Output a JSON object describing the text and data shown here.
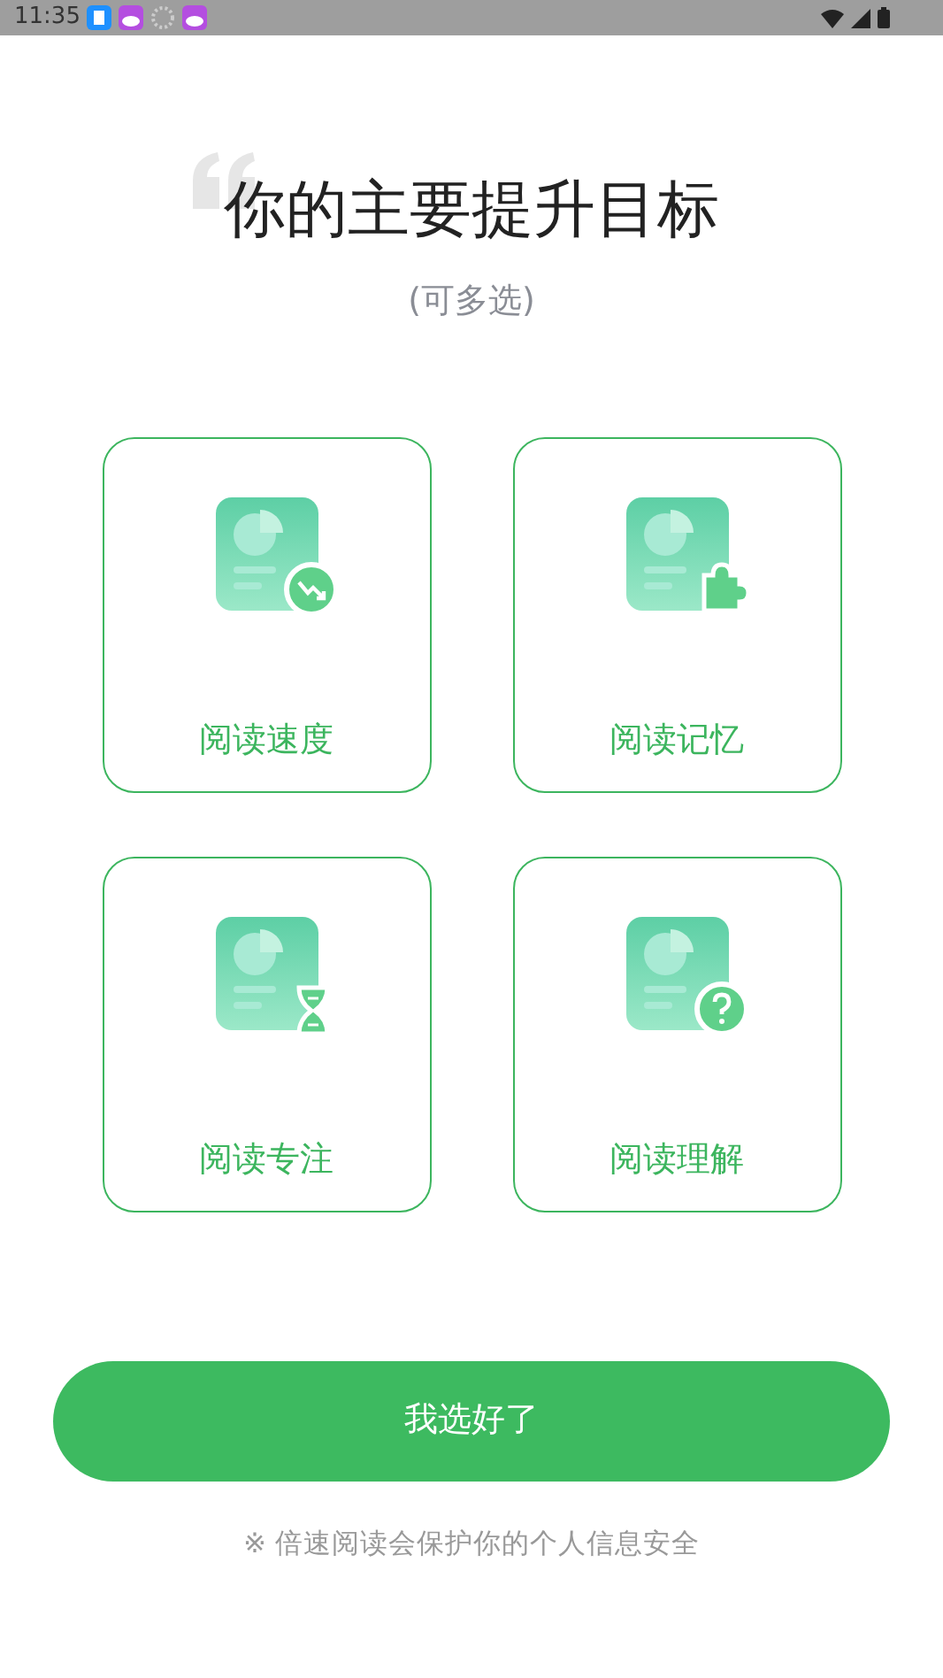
{
  "status_bar": {
    "time": "11:35"
  },
  "title": "你的主要提升目标",
  "subtitle": "(可多选)",
  "goals": [
    {
      "label": "阅读速度",
      "selected": false
    },
    {
      "label": "阅读记忆",
      "selected": false
    },
    {
      "label": "阅读专注",
      "selected": false
    },
    {
      "label": "阅读理解",
      "selected": false
    }
  ],
  "confirm_button": "我选好了",
  "footer_note": "※ 倍速阅读会保护你的个人信息安全"
}
